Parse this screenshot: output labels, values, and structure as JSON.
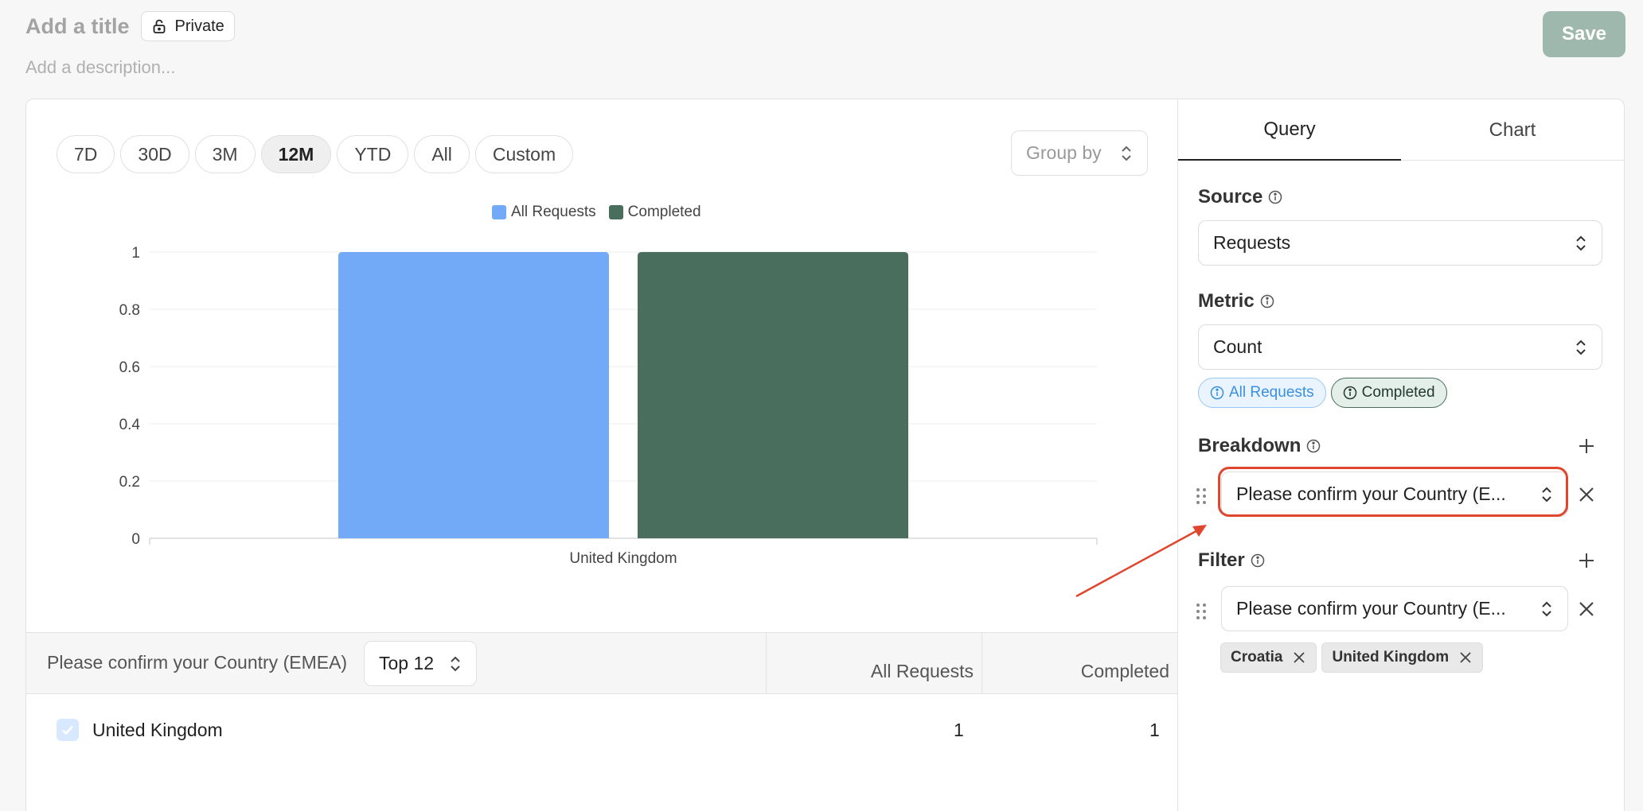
{
  "header": {
    "title_placeholder": "Add a title",
    "private_label": "Private",
    "description_placeholder": "Add a description...",
    "save_label": "Save"
  },
  "range_tabs": [
    "7D",
    "30D",
    "3M",
    "12M",
    "YTD",
    "All",
    "Custom"
  ],
  "active_range": "12M",
  "group_by_placeholder": "Group by",
  "chart_data": {
    "type": "bar",
    "categories": [
      "United Kingdom"
    ],
    "series": [
      {
        "name": "All Requests",
        "values": [
          1
        ],
        "color": "#72aaf7"
      },
      {
        "name": "Completed",
        "values": [
          1
        ],
        "color": "#4a6e5e"
      }
    ],
    "yticks": [
      "0",
      "0.2",
      "0.4",
      "0.6",
      "0.8",
      "1"
    ],
    "ylim": [
      0,
      1
    ],
    "legend_position": "top-center",
    "grid": true
  },
  "table": {
    "breakdown_header": "Please confirm your Country (EMEA)",
    "top_n": "Top 12",
    "columns": [
      "All Requests",
      "Completed"
    ],
    "rows": [
      {
        "country": "United Kingdom",
        "all_requests": "1",
        "completed": "1",
        "checked": true
      }
    ]
  },
  "side": {
    "tabs": [
      "Query",
      "Chart"
    ],
    "active_tab": "Query",
    "source_label": "Source",
    "source_value": "Requests",
    "metric_label": "Metric",
    "metric_value": "Count",
    "metric_badges": [
      "All Requests",
      "Completed"
    ],
    "breakdown_label": "Breakdown",
    "breakdown_value": "Please confirm your Country (E...",
    "filter_label": "Filter",
    "filter_value": "Please confirm your Country (E...",
    "filter_chips": [
      "Croatia",
      "United Kingdom"
    ]
  },
  "colors": {
    "accent_red": "#e0452d",
    "blue_series": "#72aaf7",
    "green_series": "#4a6e5e"
  }
}
